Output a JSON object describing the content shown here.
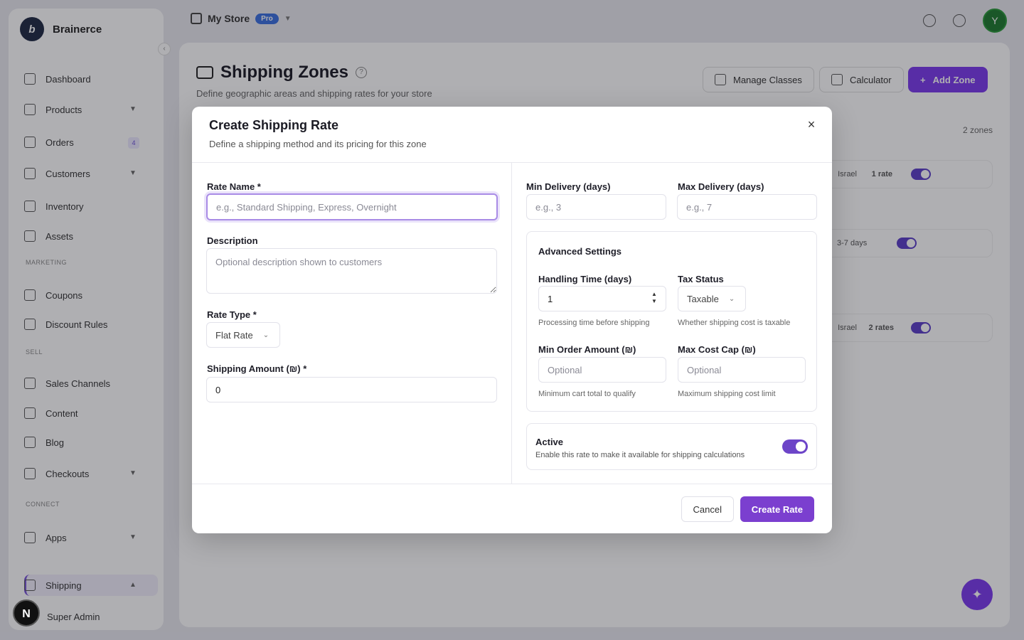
{
  "app": {
    "brand": "Brainerce",
    "store_name": "My Store",
    "plan_badge": "Pro",
    "user_initial": "Y",
    "collapse_symbol": "‹"
  },
  "sidebar": {
    "items": [
      {
        "label": "Dashboard",
        "icon": "chart-icon"
      },
      {
        "label": "Products",
        "icon": "box-icon"
      },
      {
        "label": "Orders",
        "icon": "cart-icon"
      },
      {
        "label": "Customers",
        "icon": "users-icon"
      },
      {
        "label": "Inventory",
        "icon": "grid-icon"
      },
      {
        "label": "Assets",
        "icon": "image-icon"
      },
      {
        "label": "Coupons",
        "icon": "ticket-icon"
      },
      {
        "label": "Discount Rules",
        "icon": "percent-icon"
      },
      {
        "label": "Sales Channels",
        "icon": "globe-icon"
      },
      {
        "label": "Content",
        "icon": "document-icon"
      },
      {
        "label": "Blog",
        "icon": "book-icon"
      },
      {
        "label": "Checkouts",
        "icon": "card-icon"
      },
      {
        "label": "Apps",
        "icon": "apps-icon"
      },
      {
        "label": "Shipping",
        "icon": "truck-icon"
      },
      {
        "label": "Super Admin",
        "icon": "shield-icon"
      }
    ],
    "sections": [
      "MARKETING",
      "SELL",
      "CONNECT"
    ],
    "orders_badge": "4"
  },
  "page": {
    "title": "Shipping Zones",
    "subtitle": "Define geographic areas and shipping rates for your store",
    "buttons": {
      "manage_classes": "Manage Classes",
      "calculator": "Calculator",
      "add_zone": "Add Zone"
    },
    "zones_count": "2 zones",
    "zone_rows": [
      {
        "country": "Israel",
        "rates": "1 rate"
      },
      {
        "delivery": "3-7 days"
      },
      {
        "country": "Israel",
        "rates": "2 rates"
      }
    ],
    "fab_icon": "wand-icon"
  },
  "modal": {
    "title": "Create Shipping Rate",
    "description": "Define a shipping method and its pricing for this zone",
    "close_symbol": "×",
    "rate_name": {
      "label": "Rate Name *",
      "placeholder": "e.g., Standard Shipping, Express, Overnight",
      "value": ""
    },
    "description_field": {
      "label": "Description",
      "placeholder": "Optional description shown to customers",
      "value": ""
    },
    "rate_type": {
      "label": "Rate Type *",
      "value": "Flat Rate"
    },
    "shipping_amount": {
      "label": "Shipping Amount (₪) *",
      "value": "0"
    },
    "min_delivery": {
      "label": "Min Delivery (days)",
      "placeholder": "e.g., 3"
    },
    "max_delivery": {
      "label": "Max Delivery (days)",
      "placeholder": "e.g., 7"
    },
    "advanced": {
      "title": "Advanced Settings",
      "handling_time": {
        "label": "Handling Time (days)",
        "value": "1",
        "hint": "Processing time before shipping"
      },
      "tax_status": {
        "label": "Tax Status",
        "value": "Taxable",
        "hint": "Whether shipping cost is taxable"
      },
      "min_order": {
        "label": "Min Order Amount (₪)",
        "placeholder": "Optional",
        "hint": "Minimum cart total to qualify"
      },
      "max_cost_cap": {
        "label": "Max Cost Cap (₪)",
        "placeholder": "Optional",
        "hint": "Maximum shipping cost limit"
      }
    },
    "active": {
      "title": "Active",
      "description": "Enable this rate to make it available for shipping calculations",
      "enabled": true
    },
    "cancel_label": "Cancel",
    "create_label": "Create Rate"
  },
  "colors": {
    "accent": "#7b3fcf",
    "focus_ring": "#a98be6",
    "toggle_on": "#6d45c8"
  }
}
